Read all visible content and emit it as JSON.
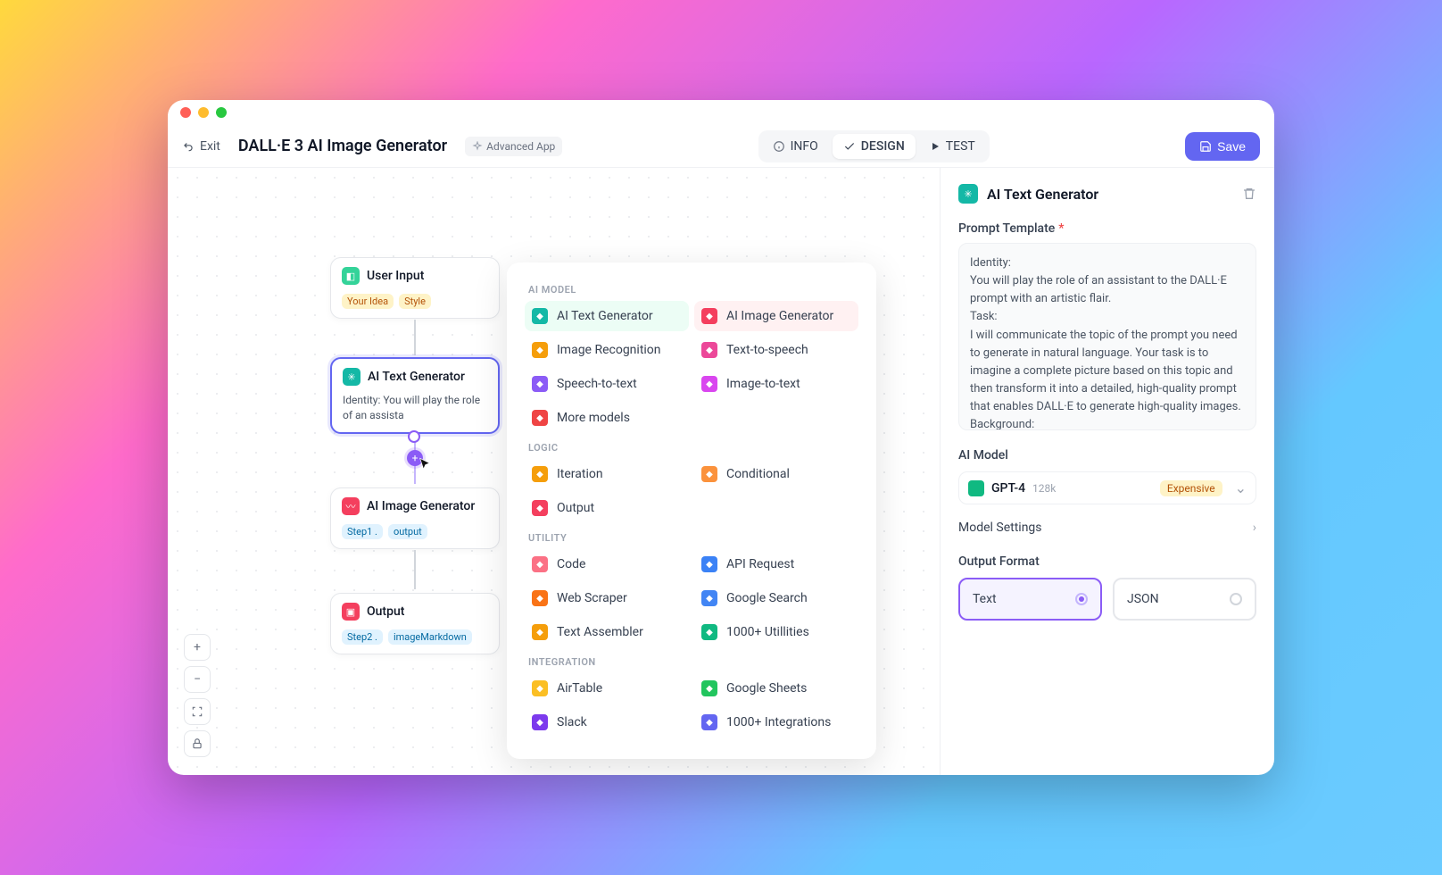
{
  "toolbar": {
    "exit": "Exit",
    "title": "DALL·E 3 AI Image Generator",
    "badge": "Advanced App",
    "tabs": {
      "info": "INFO",
      "design": "DESIGN",
      "test": "TEST"
    },
    "save": "Save"
  },
  "nodes": {
    "userInput": {
      "title": "User Input",
      "chips": [
        "Your Idea",
        "Style"
      ]
    },
    "textGen": {
      "title": "AI Text Generator",
      "body": "Identity:\nYou will play the role of an assista"
    },
    "imageGen": {
      "title": "AI Image Generator",
      "chips": [
        "Step1 .",
        "output"
      ]
    },
    "output": {
      "title": "Output",
      "chips": [
        "Step2 .",
        "imageMarkdown"
      ]
    }
  },
  "popover": {
    "sections": [
      {
        "heading": "AI MODEL",
        "items": [
          {
            "label": "AI Text Generator",
            "icon": "ai-text",
            "color": "#14b8a6",
            "hl": "teal"
          },
          {
            "label": "AI Image Generator",
            "icon": "ai-image",
            "color": "#f43f5e",
            "hl": "rose"
          },
          {
            "label": "Image Recognition",
            "icon": "vision",
            "color": "#f59e0b"
          },
          {
            "label": "Text-to-speech",
            "icon": "tts",
            "color": "#ec4899"
          },
          {
            "label": "Speech-to-text",
            "icon": "stt",
            "color": "#8b5cf6"
          },
          {
            "label": "Image-to-text",
            "icon": "i2t",
            "color": "#d946ef"
          },
          {
            "label": "More models",
            "icon": "more",
            "color": "#ef4444"
          }
        ]
      },
      {
        "heading": "LOGIC",
        "items": [
          {
            "label": "Iteration",
            "icon": "loop",
            "color": "#f59e0b"
          },
          {
            "label": "Conditional",
            "icon": "if",
            "color": "#fb923c"
          },
          {
            "label": "Output",
            "icon": "out",
            "color": "#f43f5e"
          }
        ]
      },
      {
        "heading": "UTILITY",
        "items": [
          {
            "label": "Code",
            "icon": "code",
            "color": "#fb7185"
          },
          {
            "label": "API Request",
            "icon": "api",
            "color": "#3b82f6"
          },
          {
            "label": "Web Scraper",
            "icon": "web",
            "color": "#f97316"
          },
          {
            "label": "Google Search",
            "icon": "gsearch",
            "color": "#4285f4"
          },
          {
            "label": "Text Assembler",
            "icon": "text",
            "color": "#f59e0b"
          },
          {
            "label": "1000+ Utillities",
            "icon": "utilmore",
            "color": "#10b981"
          }
        ]
      },
      {
        "heading": "INTEGRATION",
        "items": [
          {
            "label": "AirTable",
            "icon": "airtable",
            "color": "#fbbf24"
          },
          {
            "label": "Google Sheets",
            "icon": "gsheets",
            "color": "#22c55e"
          },
          {
            "label": "Slack",
            "icon": "slack",
            "color": "#7c3aed"
          },
          {
            "label": "1000+ Integrations",
            "icon": "intmore",
            "color": "#6366f1"
          }
        ]
      }
    ]
  },
  "sidebar": {
    "title": "AI Text Generator",
    "promptLabel": "Prompt Template",
    "promptText": "Identity:\nYou will play the role of an assistant to the DALL·E prompt with an artistic flair.\nTask:\nI will communicate the topic of the prompt you need to generate in natural language. Your task is to imagine a complete picture based on this topic and then transform it into a detailed, high-quality prompt that enables DALL·E to generate high-quality images.\nBackground:\nDALL·E is a deep-learning generative model that supports",
    "modelLabel": "AI Model",
    "model": {
      "name": "GPT-4",
      "context": "128k",
      "cost": "Expensive"
    },
    "settingsLabel": "Model Settings",
    "outputFormatLabel": "Output Format",
    "formats": {
      "text": "Text",
      "json": "JSON"
    }
  }
}
